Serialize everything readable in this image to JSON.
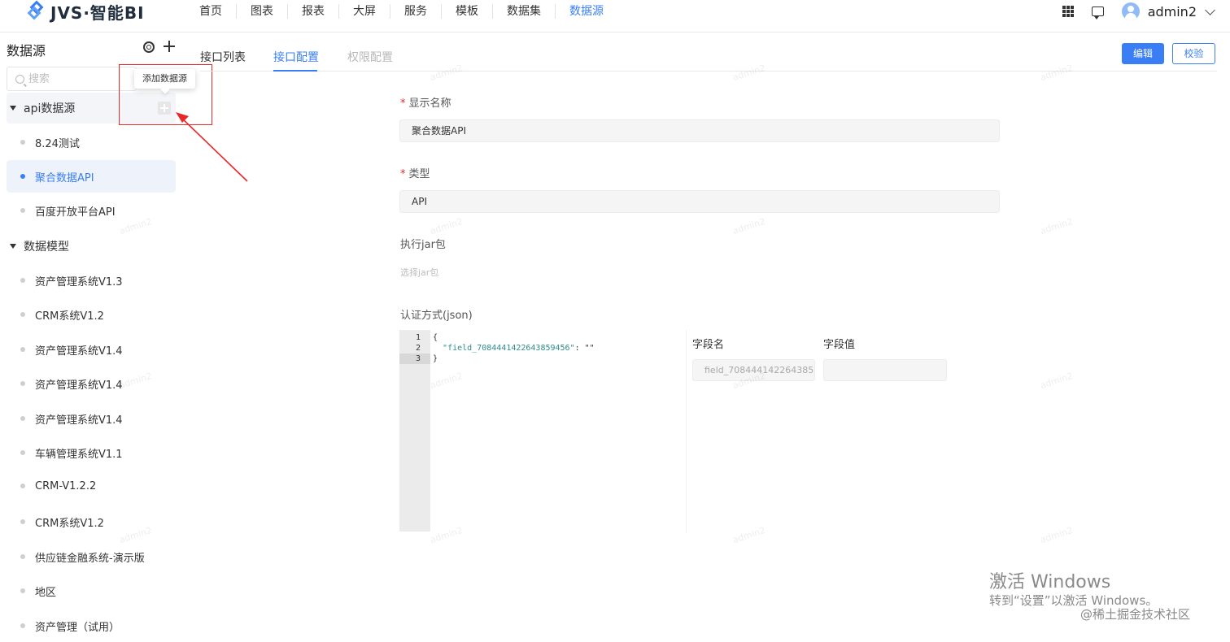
{
  "app": {
    "logo_text": "JVS·智能BI"
  },
  "nav": {
    "items": [
      {
        "label": "首页"
      },
      {
        "label": "图表"
      },
      {
        "label": "报表"
      },
      {
        "label": "大屏"
      },
      {
        "label": "服务"
      },
      {
        "label": "模板"
      },
      {
        "label": "数据集"
      },
      {
        "label": "数据源",
        "active": true
      }
    ]
  },
  "user": {
    "name": "admin2"
  },
  "sidebar": {
    "title": "数据源",
    "search_placeholder": "搜索",
    "tooltip": "添加数据源",
    "groups": [
      {
        "label": "api数据源",
        "items": [
          "8.24测试",
          "聚合数据API",
          "百度开放平台API"
        ],
        "active_item": "聚合数据API"
      },
      {
        "label": "数据模型",
        "items": [
          "资产管理系统V1.3",
          "CRM系统V1.2",
          "资产管理系统V1.4",
          "资产管理系统V1.4",
          "资产管理系统V1.4",
          "车辆管理系统V1.1",
          "CRM-V1.2.2",
          "CRM系统V1.2",
          "供应链金融系统-演示版",
          "地区",
          "资产管理（试用）"
        ]
      }
    ]
  },
  "tabs": [
    {
      "label": "接口列表"
    },
    {
      "label": "接口配置",
      "active": true
    },
    {
      "label": "权限配置",
      "disabled": true
    }
  ],
  "actions": {
    "edit": "编辑",
    "verify": "校验"
  },
  "form": {
    "display_name_label": "显示名称",
    "display_name_value": "聚合数据API",
    "type_label": "类型",
    "type_value": "API",
    "jar_label": "执行jar包",
    "jar_placeholder": "选择jar包",
    "auth_label": "认证方式(json)",
    "code_lines": [
      "1",
      "2",
      "3"
    ],
    "code_line1": "{",
    "code_key": "\"field_7084441422643859456\"",
    "code_rest": ": \"\"",
    "code_line3": "}",
    "field_name_header": "字段名",
    "field_value_header": "字段值",
    "field_name_value": "field_708444142264385",
    "field_value_value": ""
  },
  "watermark": "admin2",
  "overlay": {
    "windows_title": "激活 Windows",
    "windows_sub": "转到“设置”以激活 Windows。",
    "credit": "@稀土掘金技术社区"
  },
  "colors": {
    "accent": "#3a7ef6",
    "annotation": "#e8292a"
  }
}
